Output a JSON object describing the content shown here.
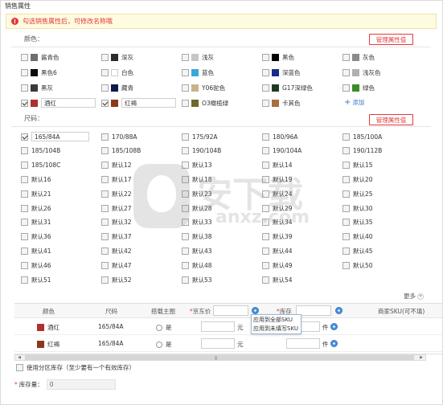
{
  "panel_title": "销售属性",
  "alert_text": "勾选销售属性后，可修改名称哦",
  "color_section": {
    "label": "颜色：",
    "manage_button": "管理属性值",
    "add_label": "添加",
    "items": [
      {
        "label": "酱青色",
        "swatch": "#6e6e6e",
        "checked": false,
        "editable": false
      },
      {
        "label": "深灰",
        "swatch": "#2b2b2b",
        "checked": false,
        "editable": false
      },
      {
        "label": "浅灰",
        "swatch": "#c6c6c6",
        "checked": false,
        "editable": false
      },
      {
        "label": "黑色",
        "swatch": "#000000",
        "checked": false,
        "editable": false
      },
      {
        "label": "灰色",
        "swatch": "#8c8c8c",
        "checked": false,
        "editable": false
      },
      {
        "label": "黑色6",
        "swatch": "#0a0a0a",
        "checked": false,
        "editable": false
      },
      {
        "label": "白色",
        "swatch": "#ffffff",
        "checked": false,
        "editable": false
      },
      {
        "label": "蓝色",
        "swatch": "#3aa8d8",
        "checked": false,
        "editable": false
      },
      {
        "label": "深蓝色",
        "swatch": "#1a2a8c",
        "checked": false,
        "editable": false
      },
      {
        "label": "浅灰色",
        "swatch": "#b0b0b0",
        "checked": false,
        "editable": false
      },
      {
        "label": "黑灰",
        "swatch": "#3a3a3a",
        "checked": false,
        "editable": false
      },
      {
        "label": "藏青",
        "swatch": "#0d1a4a",
        "checked": false,
        "editable": false
      },
      {
        "label": "Y06驼色",
        "swatch": "#c9b48a",
        "checked": false,
        "editable": false
      },
      {
        "label": "G17深绿色",
        "swatch": "#1f3a22",
        "checked": false,
        "editable": false
      },
      {
        "label": "绿色",
        "swatch": "#3a8c2a",
        "checked": false,
        "editable": false
      },
      {
        "label": "酒红",
        "swatch": "#b03030",
        "checked": true,
        "editable": true
      },
      {
        "label": "红褐",
        "swatch": "#8a3a1a",
        "checked": true,
        "editable": true
      },
      {
        "label": "O3橄榄绿",
        "swatch": "#6a6a2a",
        "checked": false,
        "editable": false
      },
      {
        "label": "卡其色",
        "swatch": "#a8703a",
        "checked": false,
        "editable": false
      }
    ]
  },
  "size_section": {
    "label": "尺码：",
    "manage_button": "管理属性值",
    "more_label": "更多",
    "items": [
      {
        "label": "165/84A",
        "checked": true,
        "editable": true
      },
      {
        "label": "170/88A",
        "checked": false
      },
      {
        "label": "175/92A",
        "checked": false
      },
      {
        "label": "180/96A",
        "checked": false
      },
      {
        "label": "185/100A",
        "checked": false
      },
      {
        "label": "185/104B",
        "checked": false
      },
      {
        "label": "185/108B",
        "checked": false
      },
      {
        "label": "190/104B",
        "checked": false
      },
      {
        "label": "190/104A",
        "checked": false
      },
      {
        "label": "190/112B",
        "checked": false
      },
      {
        "label": "185/108C",
        "checked": false
      },
      {
        "label": "默认12",
        "checked": false
      },
      {
        "label": "默认13",
        "checked": false
      },
      {
        "label": "默认14",
        "checked": false
      },
      {
        "label": "默认15",
        "checked": false
      },
      {
        "label": "默认16",
        "checked": false
      },
      {
        "label": "默认17",
        "checked": false
      },
      {
        "label": "默认18",
        "checked": false
      },
      {
        "label": "默认19",
        "checked": false
      },
      {
        "label": "默认20",
        "checked": false
      },
      {
        "label": "默认21",
        "checked": false
      },
      {
        "label": "默认22",
        "checked": false
      },
      {
        "label": "默认23",
        "checked": false
      },
      {
        "label": "默认24",
        "checked": false
      },
      {
        "label": "默认25",
        "checked": false
      },
      {
        "label": "默认26",
        "checked": false
      },
      {
        "label": "默认27",
        "checked": false
      },
      {
        "label": "默认28",
        "checked": false
      },
      {
        "label": "默认29",
        "checked": false
      },
      {
        "label": "默认30",
        "checked": false
      },
      {
        "label": "默认31",
        "checked": false
      },
      {
        "label": "默认32",
        "checked": false
      },
      {
        "label": "默认33",
        "checked": false
      },
      {
        "label": "默认34",
        "checked": false
      },
      {
        "label": "默认35",
        "checked": false
      },
      {
        "label": "默认36",
        "checked": false
      },
      {
        "label": "默认37",
        "checked": false
      },
      {
        "label": "默认38",
        "checked": false
      },
      {
        "label": "默认39",
        "checked": false
      },
      {
        "label": "默认40",
        "checked": false
      },
      {
        "label": "默认41",
        "checked": false
      },
      {
        "label": "默认42",
        "checked": false
      },
      {
        "label": "默认43",
        "checked": false
      },
      {
        "label": "默认44",
        "checked": false
      },
      {
        "label": "默认45",
        "checked": false
      },
      {
        "label": "默认46",
        "checked": false
      },
      {
        "label": "默认47",
        "checked": false
      },
      {
        "label": "默认48",
        "checked": false
      },
      {
        "label": "默认49",
        "checked": false
      },
      {
        "label": "默认50",
        "checked": false
      },
      {
        "label": "默认51",
        "checked": false
      },
      {
        "label": "默认52",
        "checked": false
      },
      {
        "label": "默认53",
        "checked": false
      },
      {
        "label": "默认54",
        "checked": false
      }
    ]
  },
  "sku_table": {
    "headers": {
      "color": "颜色",
      "size": "尺码",
      "main_image": "搭载主图",
      "price_req": "*",
      "price": "京东价",
      "stock_req": "*",
      "stock": "库存",
      "merchant_sku": "商家SKU(可不填)"
    },
    "rows": [
      {
        "color": "酒红",
        "swatch": "#b03030",
        "size": "165/84A",
        "main_image": "是",
        "price_unit": "元",
        "stock_unit": "件"
      },
      {
        "color": "红褐",
        "swatch": "#8a3a1a",
        "size": "165/84A",
        "main_image": "是",
        "price_unit": "元",
        "stock_unit": "件"
      }
    ],
    "popup": [
      "应用到全部SKU",
      "应用到未填写SKU"
    ]
  },
  "zone_stock_label": "使用分区库存（至少要有一个有效库存）",
  "stock_total": {
    "req": "*",
    "label": "库存量：",
    "value": "0"
  },
  "watermark": {
    "text": "安下载",
    "sub": "anxz.com"
  }
}
